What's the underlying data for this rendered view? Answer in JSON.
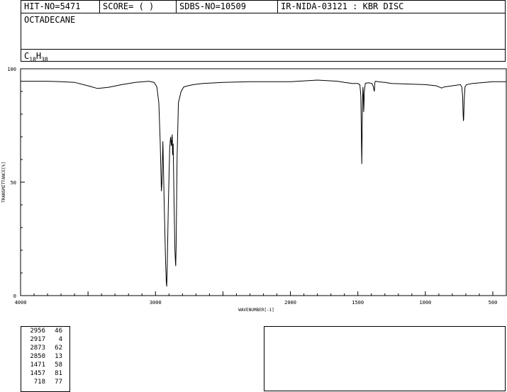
{
  "header": {
    "hit_no": "HIT-NO=5471",
    "score": "SCORE=  (  )",
    "sdbs_no": "SDBS-NO=10509",
    "ir_code": "IR-NIDA-03121 : KBR DISC",
    "compound_name": "OCTADECANE",
    "formula_c": "C",
    "formula_c_count": "18",
    "formula_h": "H",
    "formula_h_count": "38"
  },
  "peak_table": [
    {
      "wavenumber": "2956",
      "transmittance": "46"
    },
    {
      "wavenumber": "2917",
      "transmittance": "4"
    },
    {
      "wavenumber": "2873",
      "transmittance": "62"
    },
    {
      "wavenumber": "2850",
      "transmittance": "13"
    },
    {
      "wavenumber": "1471",
      "transmittance": "58"
    },
    {
      "wavenumber": "1457",
      "transmittance": "81"
    },
    {
      "wavenumber": "718",
      "transmittance": "77"
    }
  ],
  "chart_data": {
    "type": "line",
    "xlabel": "WAVENUMBER[-1]",
    "ylabel": "TRANSMITTANCE[%]",
    "xlim": [
      4000,
      400
    ],
    "ylim": [
      0,
      100
    ],
    "x_ticks": [
      4000,
      3000,
      2000,
      1500,
      1000,
      500
    ],
    "x_tick_labels": [
      "4000",
      "3000",
      "2000",
      "1500",
      "1000",
      "500"
    ],
    "y_ticks": [
      0,
      50,
      100
    ],
    "y_tick_labels": [
      "0",
      "50",
      "100"
    ],
    "series": [
      {
        "color": "#000000",
        "x": [
          4000,
          3800,
          3700,
          3600,
          3500,
          3430,
          3350,
          3250,
          3150,
          3050,
          3010,
          2990,
          2975,
          2965,
          2960,
          2956,
          2952,
          2945,
          2935,
          2925,
          2920,
          2917,
          2913,
          2905,
          2895,
          2888,
          2882,
          2876,
          2873,
          2869,
          2862,
          2856,
          2852,
          2850,
          2847,
          2840,
          2830,
          2810,
          2790,
          2760,
          2720,
          2650,
          2500,
          2300,
          2000,
          1800,
          1650,
          1600,
          1540,
          1500,
          1485,
          1478,
          1474,
          1472,
          1471,
          1470,
          1466,
          1462,
          1459,
          1457,
          1455,
          1452,
          1445,
          1440,
          1420,
          1395,
          1385,
          1378,
          1374,
          1370,
          1365,
          1355,
          1300,
          1250,
          1000,
          920,
          900,
          880,
          860,
          800,
          740,
          730,
          724,
          721,
          718,
          716,
          712,
          706,
          695,
          650,
          500,
          400
        ],
        "y": [
          94.5,
          94.5,
          94.3,
          94,
          92.5,
          91.3,
          91.8,
          93,
          94,
          94.5,
          94,
          92,
          85,
          68,
          55,
          46,
          50,
          68,
          40,
          15,
          6,
          4,
          12,
          40,
          65,
          70,
          66,
          71,
          62,
          67,
          40,
          20,
          15,
          13,
          22,
          60,
          85,
          90,
          92,
          92.5,
          93,
          93.5,
          94,
          94.3,
          94.3,
          95,
          94.5,
          94,
          93.5,
          93.5,
          93,
          88,
          72,
          62,
          58,
          63,
          85,
          92,
          88,
          81,
          84,
          90,
          93.5,
          93.7,
          93.8,
          93.5,
          92,
          90,
          94,
          94.5,
          94.5,
          94.3,
          94,
          93.5,
          93,
          92.5,
          92,
          91.5,
          92,
          92.5,
          93,
          92,
          88,
          82,
          77,
          78,
          86,
          92,
          93,
          93.5,
          94.3,
          94.3
        ]
      }
    ]
  }
}
